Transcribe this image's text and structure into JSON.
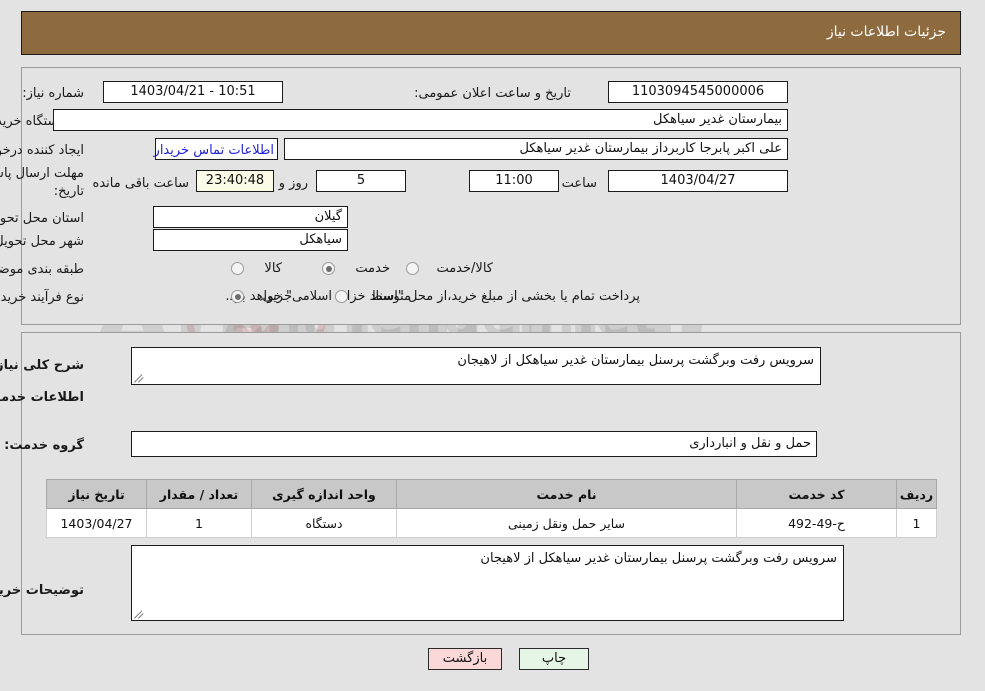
{
  "header": {
    "title": "جزئیات اطلاعات نیاز"
  },
  "top": {
    "need_number_label": "شماره نیاز:",
    "need_number_value": "1103094545000006",
    "announce_label": "تاریخ و ساعت اعلان عمومی:",
    "announce_value": "10:51 - 1403/04/21",
    "buyer_org_label": "نام دستگاه خریدار:",
    "buyer_org_value": "بیمارستان غدیر سیاهکل",
    "creator_label": "ایجاد کننده درخواست:",
    "creator_value": "علی اکبر پابرجا کاربرداز بیمارستان غدیر سیاهکل",
    "contact_link": "اطلاعات تماس خریدار",
    "deadline_label_line1": "مهلت ارسال پاسخ: تا",
    "deadline_label_line2": "تاریخ:",
    "deadline_date": "1403/04/27",
    "hour_label": "ساعت",
    "hour_value": "11:00",
    "days_value": "5",
    "days_unit": "روز و",
    "countdown_value": "23:40:48",
    "countdown_unit": "ساعت باقی مانده",
    "province_label": "استان محل تحویل:",
    "province_value": "گیلان",
    "city_label": "شهر محل تحویل:",
    "city_value": "سیاهکل",
    "category_label": "طبقه بندی موضوعی:",
    "category_options": [
      "کالا",
      "خدمت",
      "کالا/خدمت"
    ],
    "category_selected": "خدمت",
    "process_label": "نوع فرآیند خرید :",
    "process_options": [
      "جزیی",
      "متوسط"
    ],
    "process_selected": "جزیی",
    "payment_note": "پرداخت تمام یا بخشی از مبلغ خرید،از محل \"اسناد خزانه اسلامی\" خواهد بود."
  },
  "detail": {
    "summary_label": "شرح کلی نیاز:",
    "summary_value": "سرویس رفت وبرگشت پرسنل بیمارستان غدیر سیاهکل  از لاهیجان",
    "services_heading": "اطلاعات خدمات مورد نیاز",
    "service_group_label": "گروه خدمت:",
    "service_group_value": "حمل و نقل و انبارداری",
    "table": {
      "columns": [
        "ردیف",
        "کد خدمت",
        "نام خدمت",
        "واحد اندازه گیری",
        "تعداد / مقدار",
        "تاریخ نیاز"
      ],
      "rows": [
        {
          "row": "1",
          "code": "ح-49-492",
          "name": "سایر حمل ونقل زمینی",
          "unit": "دستگاه",
          "qty": "1",
          "date": "1403/04/27"
        }
      ]
    },
    "buyer_notes_label": "توضیحات خریدار:",
    "buyer_notes_value": "سرویس رفت وبرگشت پرسنل بیمارستان غدیر سیاهکل  از لاهیجان"
  },
  "footer": {
    "print_label": "چاپ",
    "back_label": "بازگشت"
  },
  "watermark": {
    "text": "AnaTender.net",
    "big": "AnaTender"
  },
  "colors": {
    "header_bar": "#8d6b3f",
    "page_bg": "#e3e3e3",
    "link": "#2222dd",
    "print_btn": "#e6f6e6",
    "back_btn": "#fbd8d8",
    "countdown_bg": "#fbfbe8",
    "table_header": "#c8c8c8"
  }
}
